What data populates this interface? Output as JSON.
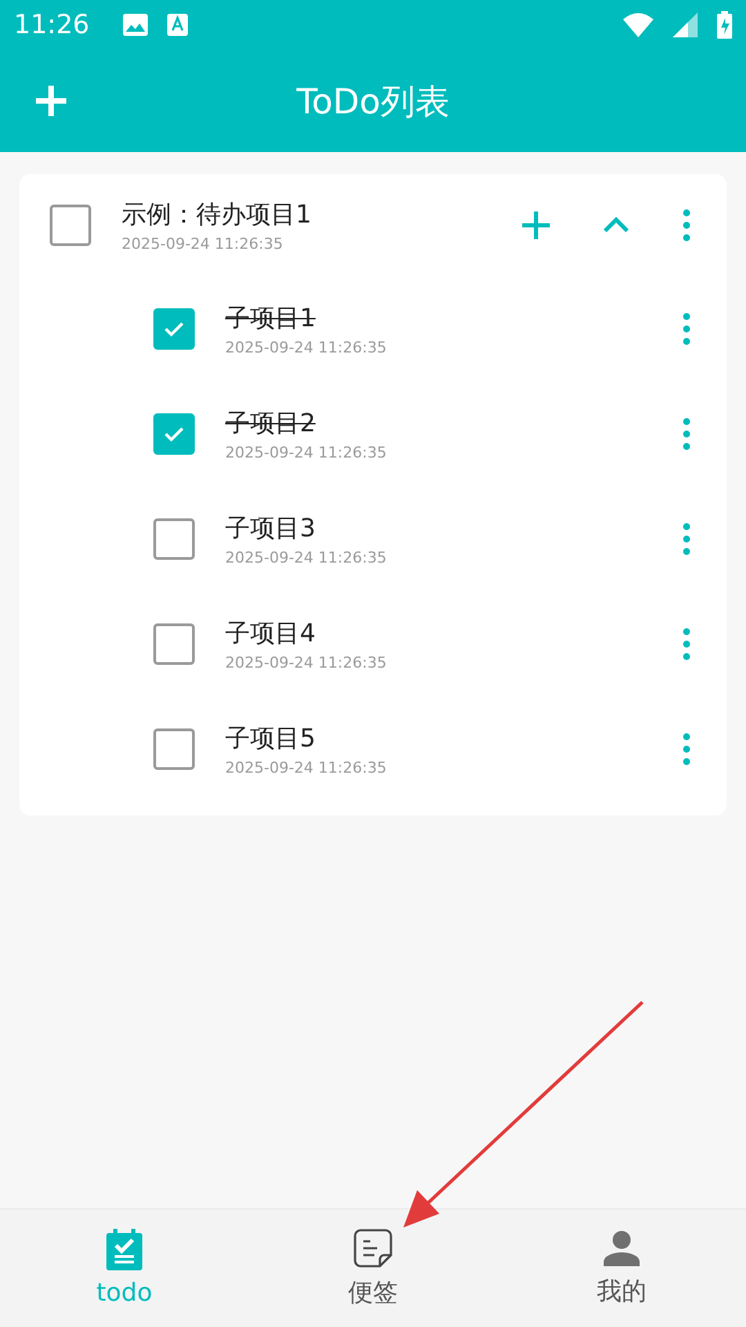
{
  "status_bar": {
    "time": "11:26"
  },
  "app_bar": {
    "title": "ToDo列表"
  },
  "todos": [
    {
      "title": "示例：待办项目1",
      "time": "2025-09-24 11:26:35",
      "checked": false,
      "expanded": true,
      "children": [
        {
          "title": "子项目1",
          "time": "2025-09-24 11:26:35",
          "checked": true
        },
        {
          "title": "子项目2",
          "time": "2025-09-24 11:26:35",
          "checked": true
        },
        {
          "title": "子项目3",
          "time": "2025-09-24 11:26:35",
          "checked": false
        },
        {
          "title": "子项目4",
          "time": "2025-09-24 11:26:35",
          "checked": false
        },
        {
          "title": "子项目5",
          "time": "2025-09-24 11:26:35",
          "checked": false
        }
      ]
    }
  ],
  "bottom_nav": [
    {
      "label": "todo",
      "kind": "todo",
      "selected": true
    },
    {
      "label": "便签",
      "kind": "note",
      "selected": false
    },
    {
      "label": "我的",
      "kind": "profile",
      "selected": false
    }
  ]
}
